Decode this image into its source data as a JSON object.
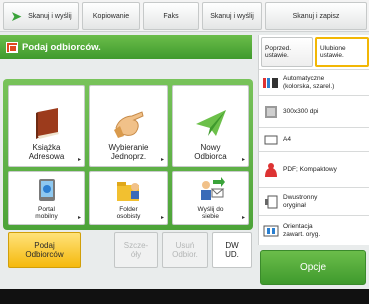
{
  "top_tabs": [
    {
      "label": "Skanuj i wyślij"
    },
    {
      "label": "Kopiowanie"
    },
    {
      "label": "Faks"
    },
    {
      "label": "Skanuj i wyślij"
    },
    {
      "label": "Skanuj i zapisz"
    }
  ],
  "header": {
    "title": "Podaj odbiorców."
  },
  "tiles": {
    "address_book": "Książka\nAdresowa",
    "coded_dial": "Wybieranie\nJednoprz.",
    "new_recipient": "Nowy\nOdbiorca",
    "mobile_portal": "Portal\nmobilny",
    "personal_folder": "Folder\nosobisty",
    "send_to_myself": "Wyślij do\nsiebie"
  },
  "bottom_tabs": {
    "specify_recipients": "Podaj\nOdbiorców",
    "details": "Szcze-\nóły",
    "delete_recipient": "Usuń\nOdbior.",
    "cc_bcc": "DW\nUD."
  },
  "right_panel": {
    "previous_settings": "Poprzed.\nustawie.",
    "favorite_settings": "Ulubione\nustawie.",
    "color": "Automatyczne\n(kolorska, szarel.)",
    "resolution": "300x300 dpi",
    "paper_size": "A4",
    "file_format": "PDF; Kompaktowy",
    "duplex": "Dwustronny\noryginał",
    "orientation": "Orientacja\nzawart. oryg."
  },
  "options_button": "Opcje",
  "colors": {
    "accent_green": "#4ca338",
    "active_tab": "#f5b90d",
    "header_icon": "#e04a1f"
  }
}
